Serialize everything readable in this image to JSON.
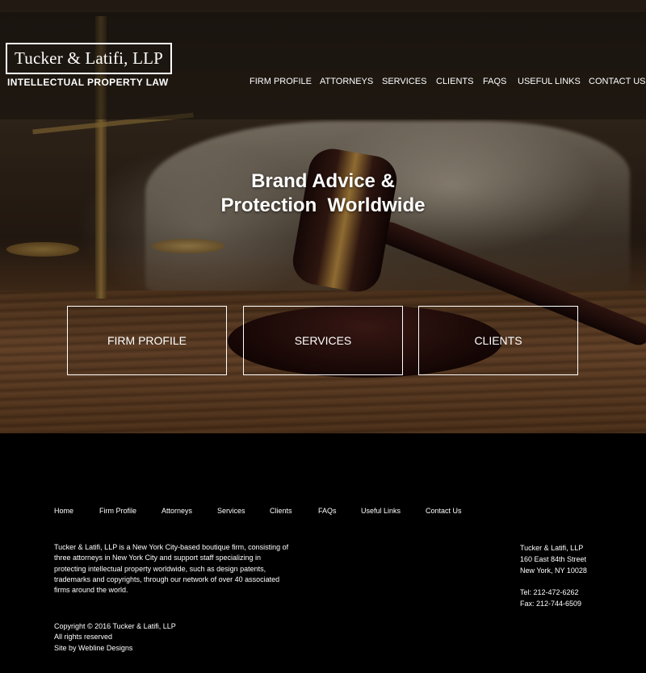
{
  "brand": {
    "name": "Tucker & Latifi, LLP",
    "tagline": "INTELLECTUAL PROPERTY LAW"
  },
  "nav": [
    {
      "label": "FIRM PROFILE"
    },
    {
      "label": "ATTORNEYS"
    },
    {
      "label": "SERVICES"
    },
    {
      "label": "CLIENTS"
    },
    {
      "label": "FAQS"
    },
    {
      "label": "USEFUL LINKS"
    },
    {
      "label": "CONTACT US"
    }
  ],
  "hero": {
    "headline_line1": "Brand Advice &",
    "headline_line2": "Protection  Worldwide",
    "buttons": [
      {
        "label": "FIRM PROFILE"
      },
      {
        "label": "SERVICES"
      },
      {
        "label": "CLIENTS"
      }
    ]
  },
  "footer": {
    "nav": [
      {
        "label": "Home"
      },
      {
        "label": "Firm Profile"
      },
      {
        "label": "Attorneys"
      },
      {
        "label": "Services"
      },
      {
        "label": "Clients"
      },
      {
        "label": "FAQs"
      },
      {
        "label": "Useful Links"
      },
      {
        "label": "Contact Us"
      }
    ],
    "about_lines": [
      "Tucker & Latifi, LLP is a New York City-based boutique firm, consisting of",
      "three attorneys in New York City and support staff specializing in",
      "protecting intellectual property worldwide, such as design patents,",
      "trademarks and copyrights, through our network of over 40 associated",
      "firms around the world."
    ],
    "address": {
      "name": "Tucker & Latifi, LLP",
      "street": "160 East 84th Street",
      "city": "New York, NY 10028"
    },
    "contact": {
      "tel": "Tel: 212-472-6262",
      "fax": "Fax: 212-744-6509"
    },
    "copyright": "Copyright © 2016 Tucker & Latifi, LLP",
    "rights": "All rights reserved",
    "credit": "Site by Webline Designs"
  }
}
